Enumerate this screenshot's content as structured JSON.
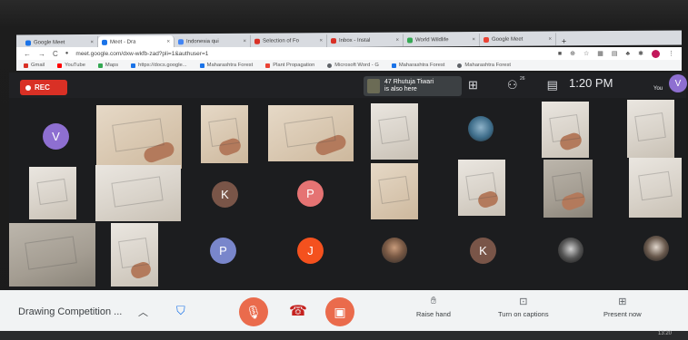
{
  "browser": {
    "tabs": [
      {
        "label": "Google Meet",
        "active": false
      },
      {
        "label": "Meet - Dra",
        "active": true
      },
      {
        "label": "Indonesia qui",
        "active": false
      },
      {
        "label": "Selection of Fo",
        "active": false
      },
      {
        "label": "Inbox - Instal",
        "active": false
      },
      {
        "label": "World Wildlife",
        "active": false
      },
      {
        "label": "Google Meet",
        "active": false
      }
    ],
    "new_tab": "+",
    "url": "meet.google.com/dxw-wkfb-zad?pli=1&authuser=1",
    "bookmarks": [
      {
        "label": "Gmail",
        "color": "#d93025"
      },
      {
        "label": "YouTube",
        "color": "#ff0000"
      },
      {
        "label": "Maps",
        "color": "#34a853"
      },
      {
        "label": "https://docs.google...",
        "color": "#1a73e8"
      },
      {
        "label": "Maharashtra Forest",
        "color": "#1a73e8"
      },
      {
        "label": "Plant Propagation",
        "color": "#ea4335"
      },
      {
        "label": "Microsoft Word - G",
        "color": "#5f6368"
      },
      {
        "label": "Maharashtra Forest",
        "color": "#1a73e8"
      },
      {
        "label": "Maharashtra Forest",
        "color": "#5f6368"
      }
    ]
  },
  "meet": {
    "rec_label": "REC",
    "joined_notice": {
      "line1": "47 Rhutuja Tiwari",
      "line2": "is also here"
    },
    "participants_count": "26",
    "time": "1:20 PM",
    "self_label": "You",
    "self_initial": "V",
    "meeting_name": "Drawing Competition ...",
    "raise_hand": "Raise hand",
    "captions": "Turn on captions",
    "present": "Present now",
    "taskbar_time": "13:20"
  },
  "tiles": {
    "avatars": [
      {
        "initial": "V",
        "color": "#8e6fd1"
      },
      {
        "initial": "K",
        "color": "#795548"
      },
      {
        "initial": "P",
        "color": "#e57373"
      },
      {
        "initial": "P",
        "color": "#7986cb"
      },
      {
        "initial": "J",
        "color": "#f4511e"
      },
      {
        "initial": "K",
        "color": "#795548"
      }
    ]
  },
  "colors": {
    "accent": "#1a73e8",
    "rec": "#d93025",
    "control": "#ea6b4c",
    "meet_bg": "#202124"
  }
}
